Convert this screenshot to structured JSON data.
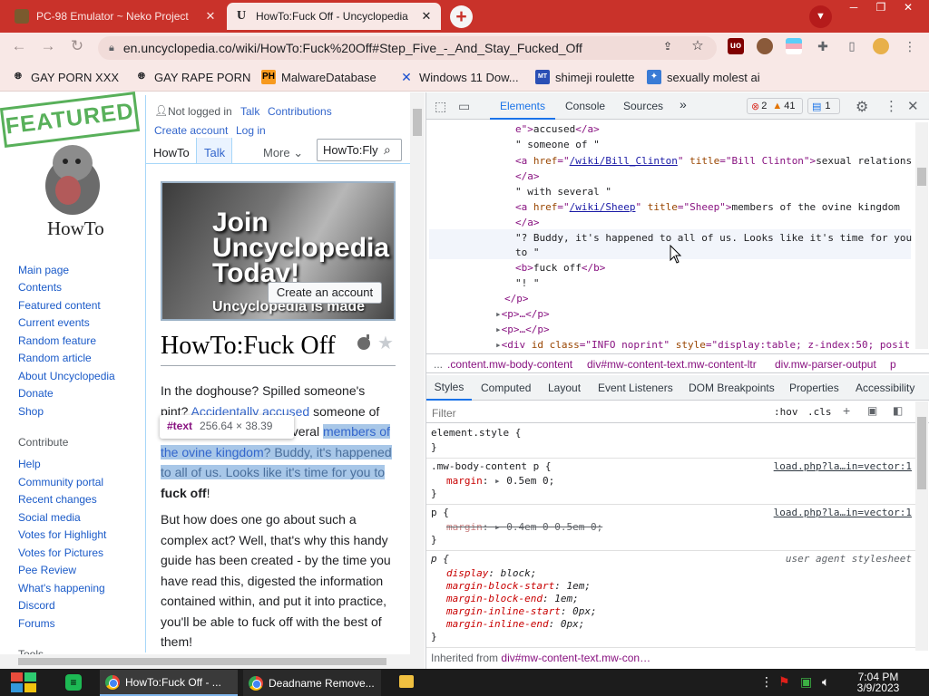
{
  "browser": {
    "tabs": [
      {
        "title": "PC-98 Emulator ~ Neko Project",
        "active": false
      },
      {
        "title": "HowTo:Fuck Off - Uncyclopedia",
        "active": true
      }
    ],
    "url": "en.uncyclopedia.co/wiki/HowTo:Fuck%20Off#Step_Five_-_And_Stay_Fucked_Off",
    "bookmarks": [
      "GAY PORN XXX",
      "GAY RAPE PORN",
      "MalwareDatabase",
      "Windows 11 Dow...",
      "shimeji roulette",
      "sexually molest ai"
    ],
    "bookmark_icons": [
      "PH"
    ],
    "accent_color": "#c9322a"
  },
  "wiki": {
    "featured_stamp": "FEATURED",
    "logo_text": "HowTo",
    "personal": {
      "not_logged_in": "Not logged in",
      "talk": "Talk",
      "contributions": "Contributions",
      "create_account": "Create account",
      "log_in": "Log in"
    },
    "ns_tabs": {
      "howto": "HowTo",
      "talk": "Talk",
      "more": "More"
    },
    "search_value": "HowTo:Fly",
    "nav": [
      "Main page",
      "Contents",
      "Featured content",
      "Current events",
      "Random feature",
      "Random article",
      "About Uncyclopedia",
      "Donate",
      "Shop"
    ],
    "contribute_heading": "Contribute",
    "contribute": [
      "Help",
      "Community portal",
      "Recent changes",
      "Social media",
      "Votes for Highlight",
      "Votes for Pictures",
      "Pee Review",
      "What's happening",
      "Discord",
      "Forums"
    ],
    "tools_heading": "Tools",
    "banner": {
      "join_text": "Join\nUncyclopedia\nToday!",
      "create_button": "Create an account",
      "made_text": "Uncyclopedia is made"
    },
    "page_title": "HowTo:Fuck Off",
    "para1": {
      "t1": "In the doghouse? Spilled someone's pint? ",
      "link1": "Accidentally accused",
      "t2": " someone of sexual relations with several ",
      "link2": "members of the ovine kingdom",
      "t3": "? Buddy, it's happened to all of us. Looks like it's time for you to ",
      "bold": "fuck off",
      "t4": "!"
    },
    "para2": "But how does one go about such a complex act? Well, that's why this handy guide has been created - by the time you have read this, digested the information contained within, and put it into practice, you'll be able to fuck off with the best of them!",
    "tooltip": {
      "name": "#text",
      "size": "256.64 × 38.39"
    }
  },
  "devtools": {
    "tabs": [
      "Elements",
      "Console",
      "Sources"
    ],
    "more": "»",
    "errors": "2",
    "warnings": "41",
    "messages": "1",
    "dom": {
      "l1a": "e\">",
      "l1b": "accused",
      "l1c": "</a>",
      "l2": "\" someone of \"",
      "l3a": "<a ",
      "l3b": "href",
      "l3c": "=\"",
      "l3d": "/wiki/Bill_Clinton",
      "l3e": "\" ",
      "l3f": "title",
      "l3g": "=\"Bill Clinton\">",
      "l3h": "sexual relations",
      "l4": "</a>",
      "l5": "\" with several \"",
      "l6a": "<a ",
      "l6b": "href",
      "l6c": "=\"",
      "l6d": "/wiki/Sheep",
      "l6e": "\" ",
      "l6f": "title",
      "l6g": "=\"Sheep\">",
      "l6h": "members of the ovine kingdom",
      "l7": "</a>",
      "l8": "\"? Buddy, it's happened to all of us. Looks like it's time for you",
      "l9": "to \"",
      "l10a": "<b>",
      "l10b": "fuck off",
      "l10c": "</b>",
      "l11": "\"! \"",
      "l12": "</p>",
      "l13": "<p>…</p>",
      "l14": "<p>…</p>",
      "l15a": "<div ",
      "l15b": "id",
      "l15c": " ",
      "l15d": "class",
      "l15e": "=\"INFO noprint\" ",
      "l15f": "style",
      "l15g": "=\"display:table; z-index:50; posit"
    },
    "breadcrumbs": [
      "...",
      ".content.mw-body-content",
      "div#mw-content-text.mw-content-ltr",
      "div.mw-parser-output",
      "p"
    ],
    "subtabs": [
      "Styles",
      "Computed",
      "Layout",
      "Event Listeners",
      "DOM Breakpoints",
      "Properties",
      "Accessibility"
    ],
    "filter_placeholder": "Filter",
    "hov": ":hov",
    "cls": ".cls",
    "rules": {
      "r1_sel": "element.style {",
      "r1_close": "}",
      "r2_sel": ".mw-body-content p {",
      "r2_src": "load.php?la…in=vector:1",
      "r2_prop": "margin",
      "r2_val": "0.5em 0;",
      "r2_close": "}",
      "r3_sel": "p {",
      "r3_src": "load.php?la…in=vector:1",
      "r3_prop": "margin",
      "r3_val": "0.4em 0 0.5em 0;",
      "r3_close": "}",
      "r4_sel": "p {",
      "r4_src": "user agent stylesheet",
      "r4_props": [
        {
          "p": "display",
          "v": "block;"
        },
        {
          "p": "margin-block-start",
          "v": "1em;"
        },
        {
          "p": "margin-block-end",
          "v": "1em;"
        },
        {
          "p": "margin-inline-start",
          "v": "0px;"
        },
        {
          "p": "margin-inline-end",
          "v": "0px;"
        }
      ],
      "r4_close": "}"
    },
    "inherited_label": "Inherited from",
    "inherited_sel": "div#mw-content-text.mw-con…"
  },
  "taskbar": {
    "apps": [
      "HowTo:Fuck Off - ...",
      "Deadname Remove..."
    ],
    "time": "7:04 PM",
    "date": "3/9/2023"
  }
}
